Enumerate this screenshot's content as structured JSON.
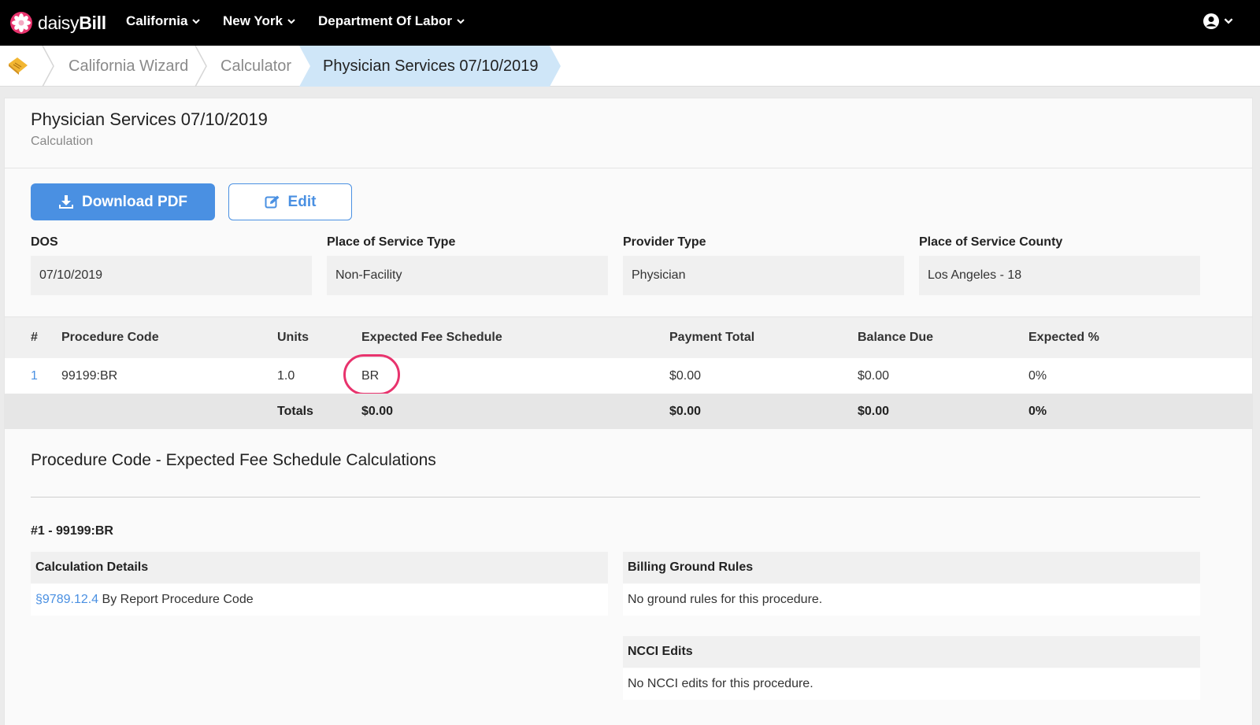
{
  "app": {
    "brand_light": "daisy",
    "brand_bold": "Bill",
    "nav": [
      "California",
      "New York",
      "Department Of Labor"
    ]
  },
  "breadcrumb": {
    "items": [
      "California Wizard",
      "Calculator",
      "Physician Services 07/10/2019"
    ]
  },
  "header": {
    "title": "Physician Services 07/10/2019",
    "subtitle": "Calculation"
  },
  "actions": {
    "download_label": "Download PDF",
    "edit_label": "Edit"
  },
  "fields": [
    {
      "label": "DOS",
      "value": "07/10/2019"
    },
    {
      "label": "Place of Service Type",
      "value": "Non-Facility"
    },
    {
      "label": "Provider Type",
      "value": "Physician"
    },
    {
      "label": "Place of Service County",
      "value": "Los Angeles - 18"
    }
  ],
  "table": {
    "headers": [
      "#",
      "Procedure Code",
      "Units",
      "Expected Fee Schedule",
      "Payment Total",
      "Balance Due",
      "Expected %"
    ],
    "rows": [
      {
        "num": "1",
        "code": "99199:BR",
        "units": "1.0",
        "expected_fee": "BR",
        "payment": "$0.00",
        "balance": "$0.00",
        "expected_pct": "0%"
      }
    ],
    "totals": {
      "label": "Totals",
      "expected_fee": "$0.00",
      "payment": "$0.00",
      "balance": "$0.00",
      "expected_pct": "0%"
    }
  },
  "calculations": {
    "title": "Procedure Code - Expected Fee Schedule Calculations",
    "procedure_heading": "#1 - 99199:BR",
    "details_title": "Calculation Details",
    "details_link": "§9789.12.4",
    "details_text": " By Report Procedure Code",
    "ground_rules_title": "Billing Ground Rules",
    "ground_rules_text": "No ground rules for this procedure.",
    "ncci_title": "NCCI Edits",
    "ncci_text": "No NCCI edits for this procedure."
  },
  "colors": {
    "accent": "#4a90e2",
    "highlight_circle": "#e8336d",
    "brand_pink": "#e8336d",
    "active_crumb": "#cfe6f8"
  }
}
